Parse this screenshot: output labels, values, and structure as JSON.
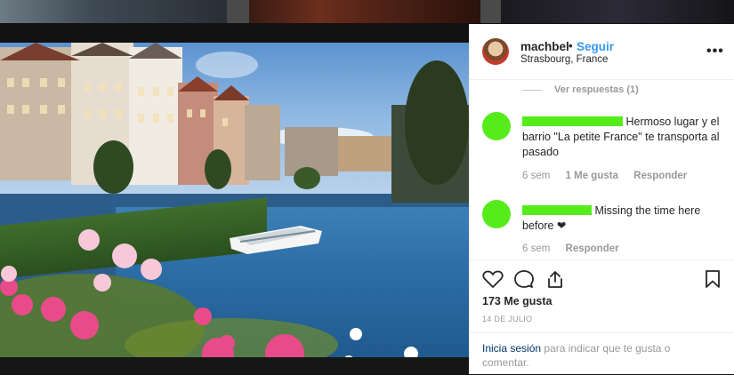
{
  "post": {
    "username": "machbel",
    "separator": "•",
    "follow_label": "Seguir",
    "location": "Strasbourg, France",
    "more_label": "•••"
  },
  "comments": {
    "view_replies": "Ver respuestas (1)",
    "items": [
      {
        "text": "Hermoso lugar y el barrio \"La petite France\" te transporta al pasado",
        "time": "6 sem",
        "likes": "1 Me gusta",
        "reply": "Responder"
      },
      {
        "text": "Missing the time here before ❤",
        "time": "6 sem",
        "reply": "Responder"
      }
    ]
  },
  "actions": {
    "like_icon": "heart-icon",
    "comment_icon": "comment-icon",
    "share_icon": "share-icon",
    "save_icon": "bookmark-icon"
  },
  "stats": {
    "likes": "173 Me gusta",
    "date": "14 DE JULIO"
  },
  "login": {
    "link": "Inicia sesión",
    "rest": " para indicar que te gusta o comentar."
  },
  "colors": {
    "accent": "#3897f0",
    "redaction": "#55ec1a"
  }
}
